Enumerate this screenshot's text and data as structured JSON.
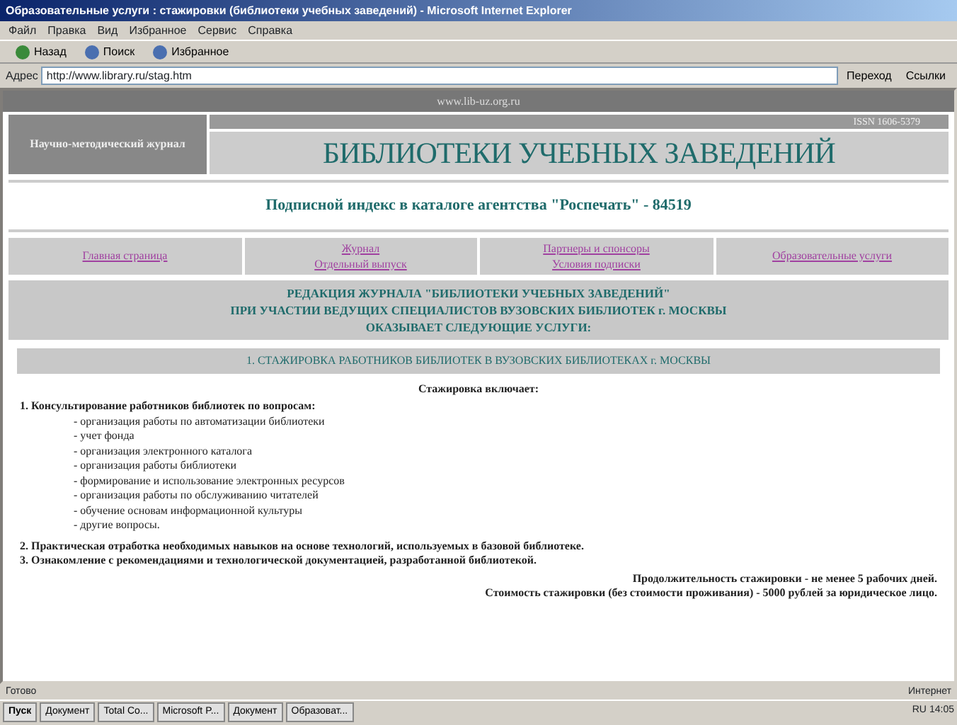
{
  "window": {
    "title": "Образовательные услуги : стажировки (библиотеки учебных заведений) - Microsoft Internet Explorer"
  },
  "menu": [
    "Файл",
    "Правка",
    "Вид",
    "Избранное",
    "Сервис",
    "Справка"
  ],
  "toolbar": [
    "Назад",
    "Поиск",
    "Избранное"
  ],
  "address": {
    "label": "Адрес",
    "value": "http://www.library.ru/stag.htm",
    "go": "Переход",
    "links": "Ссылки"
  },
  "page": {
    "top_bar": "www.lib-uz.org.ru",
    "logo_text": "Научно-методический журнал",
    "issn": "ISSN 1606-5379",
    "title": "БИБЛИОТЕКИ УЧЕБНЫХ ЗАВЕДЕНИЙ",
    "index_line": "Подписной индекс в каталоге агентства \"Роспечать\" - 84519",
    "nav": [
      {
        "lines": [
          "Главная страница"
        ]
      },
      {
        "lines": [
          "Журнал",
          "Отдельный выпуск"
        ]
      },
      {
        "lines": [
          "Партнеры и спонсоры",
          "Условия подписки"
        ]
      },
      {
        "lines": [
          "Образовательные услуги"
        ]
      }
    ],
    "heading_lines": [
      "РЕДАКЦИЯ ЖУРНАЛА \"БИБЛИОТЕКИ УЧЕБНЫХ ЗАВЕДЕНИЙ\"",
      "ПРИ УЧАСТИИ ВЕДУЩИХ СПЕЦИАЛИСТОВ ВУЗОВСКИХ БИБЛИОТЕК г. МОСКВЫ",
      "ОКАЗЫВАЕТ СЛЕДУЮЩИЕ УСЛУГИ:"
    ],
    "section_title": "1. СТАЖИРОВКА РАБОТНИКОВ БИБЛИОТЕК В ВУЗОВСКИХ БИБЛИОТЕКАХ г. МОСКВЫ",
    "intro": "Стажировка включает:",
    "items": [
      {
        "text": "1. Консультирование работников библиотек по вопросам:",
        "bullets": [
          "- организация работы по автоматизации библиотеки",
          "- учет фонда",
          "- организация электронного каталога",
          "- организация работы библиотеки",
          "- формирование и использование электронных ресурсов",
          "- организация работы по обслуживанию читателей",
          "- обучение основам информационной культуры",
          "- другие вопросы."
        ]
      },
      {
        "text": "2. Практическая отработка необходимых навыков на основе технологий, используемых в базовой библиотеке."
      },
      {
        "text": "3. Ознакомление с рекомендациями и технологической документацией, разработанной библиотекой."
      }
    ],
    "notes": [
      "Продолжительность стажировки - не менее 5 рабочих дней.",
      "Стоимость стажировки (без стоимости проживания) - 5000 рублей за юридическое лицо."
    ]
  },
  "status_bar": {
    "text": "Готово",
    "zone": "Интернет"
  },
  "taskbar": {
    "start": "Пуск",
    "items": [
      "Документ",
      "Total Co...",
      "Microsoft P...",
      "Документ",
      "Образоват..."
    ],
    "tray": "RU",
    "clock": "14:05"
  }
}
